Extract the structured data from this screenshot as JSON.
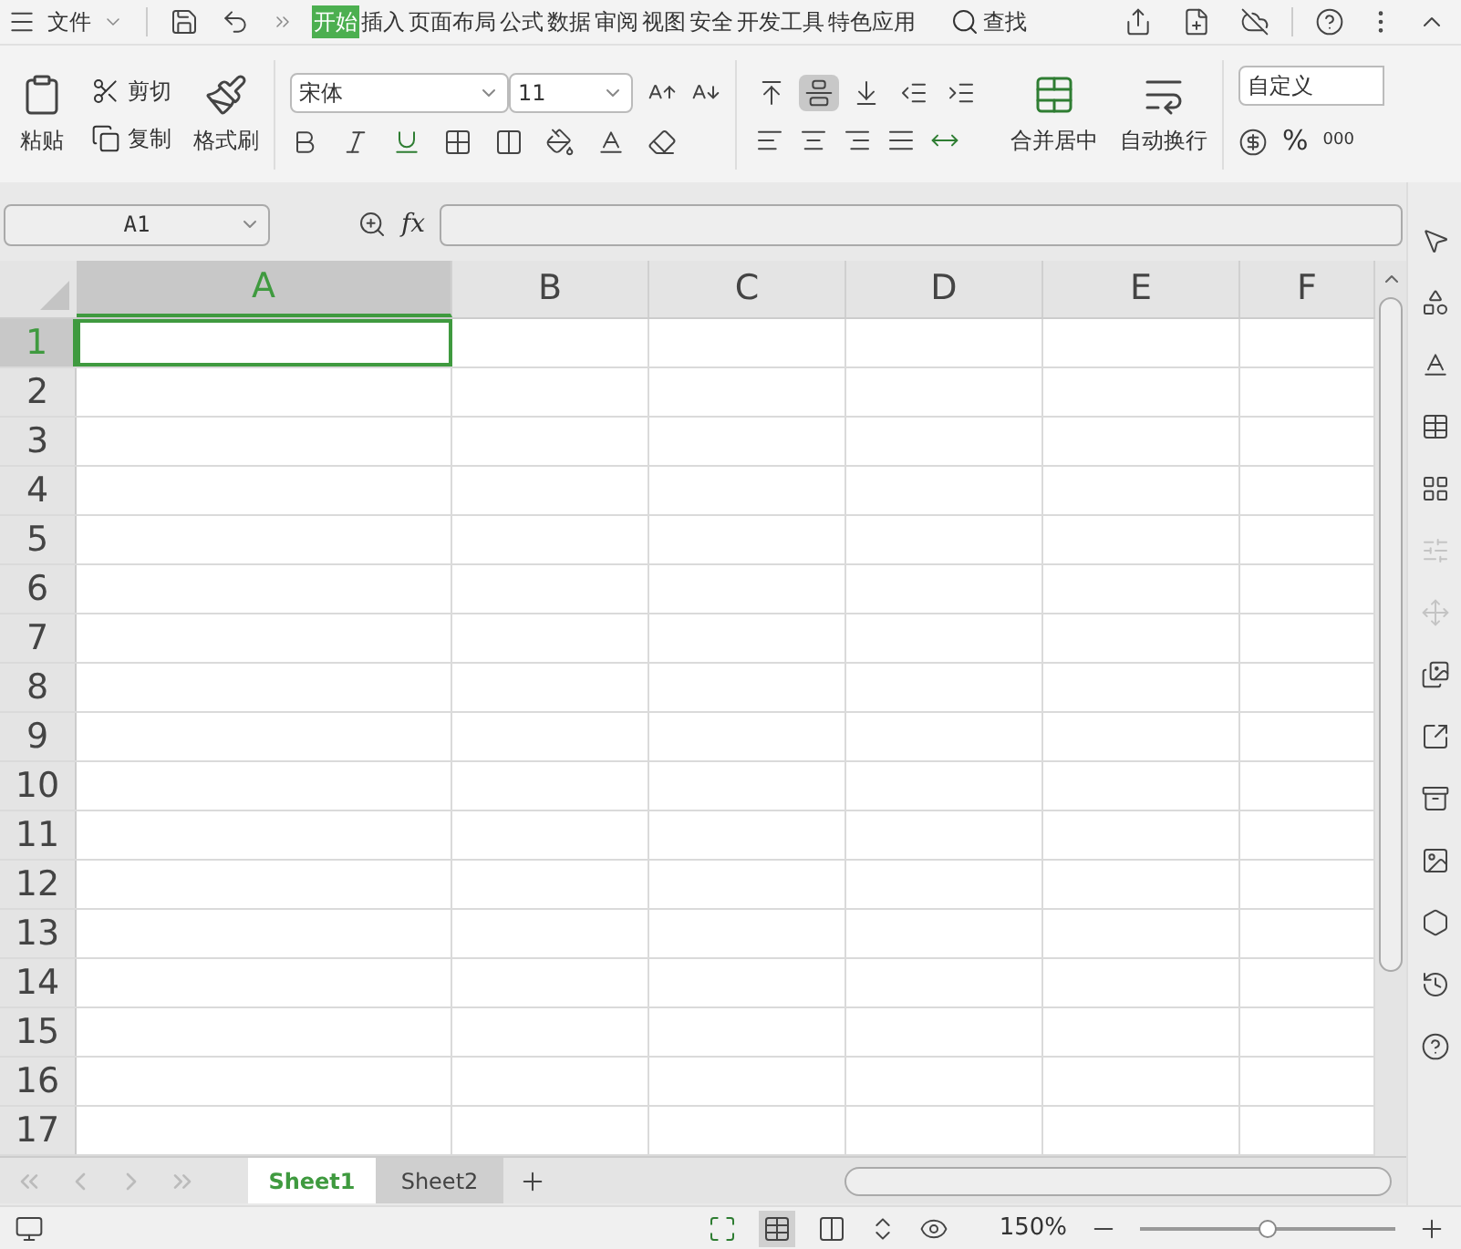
{
  "menu": {
    "file": "文件",
    "tabs": [
      {
        "label": "开始",
        "selected": true
      },
      {
        "label": "插入",
        "selected": false
      },
      {
        "label": "页面布局",
        "selected": false
      },
      {
        "label": "公式",
        "selected": false
      },
      {
        "label": "数据",
        "selected": false
      },
      {
        "label": "审阅",
        "selected": false
      },
      {
        "label": "视图",
        "selected": false
      },
      {
        "label": "安全",
        "selected": false
      },
      {
        "label": "开发工具",
        "selected": false
      },
      {
        "label": "特色应用",
        "selected": false
      }
    ],
    "search": "查找"
  },
  "ribbon": {
    "paste": "粘贴",
    "cut": "剪切",
    "copy": "复制",
    "format_painter": "格式刷",
    "font": "宋体",
    "font_size": "11",
    "align_buttons": [
      {
        "kind": "top",
        "selected": false
      },
      {
        "kind": "middle",
        "selected": true
      },
      {
        "kind": "bottom",
        "selected": false
      },
      {
        "kind": "outdent",
        "selected": false
      },
      {
        "kind": "indent",
        "selected": false
      }
    ],
    "merge": "合并居中",
    "wrap": "自动换行",
    "number_format": "自定义",
    "percent": "%",
    "thousands": "000"
  },
  "formula_bar": {
    "name_box": "A1",
    "fx": "fx"
  },
  "columns": [
    {
      "label": "A",
      "selected": true
    },
    {
      "label": "B",
      "selected": false
    },
    {
      "label": "C",
      "selected": false
    },
    {
      "label": "D",
      "selected": false
    },
    {
      "label": "E",
      "selected": false
    },
    {
      "label": "F",
      "selected": false
    }
  ],
  "rows": [
    {
      "label": "1",
      "selected": true
    },
    {
      "label": "2",
      "selected": false
    },
    {
      "label": "3",
      "selected": false
    },
    {
      "label": "4",
      "selected": false
    },
    {
      "label": "5",
      "selected": false
    },
    {
      "label": "6",
      "selected": false
    },
    {
      "label": "7",
      "selected": false
    },
    {
      "label": "8",
      "selected": false
    },
    {
      "label": "9",
      "selected": false
    },
    {
      "label": "10",
      "selected": false
    },
    {
      "label": "11",
      "selected": false
    },
    {
      "label": "12",
      "selected": false
    },
    {
      "label": "13",
      "selected": false
    },
    {
      "label": "14",
      "selected": false
    },
    {
      "label": "15",
      "selected": false
    },
    {
      "label": "16",
      "selected": false
    },
    {
      "label": "17",
      "selected": false
    }
  ],
  "sheets": [
    {
      "label": "Sheet1",
      "selected": true
    },
    {
      "label": "Sheet2",
      "selected": false
    }
  ],
  "status_bar": {
    "zoom": "150%",
    "zoom_slider": {
      "level": 0.5
    }
  }
}
